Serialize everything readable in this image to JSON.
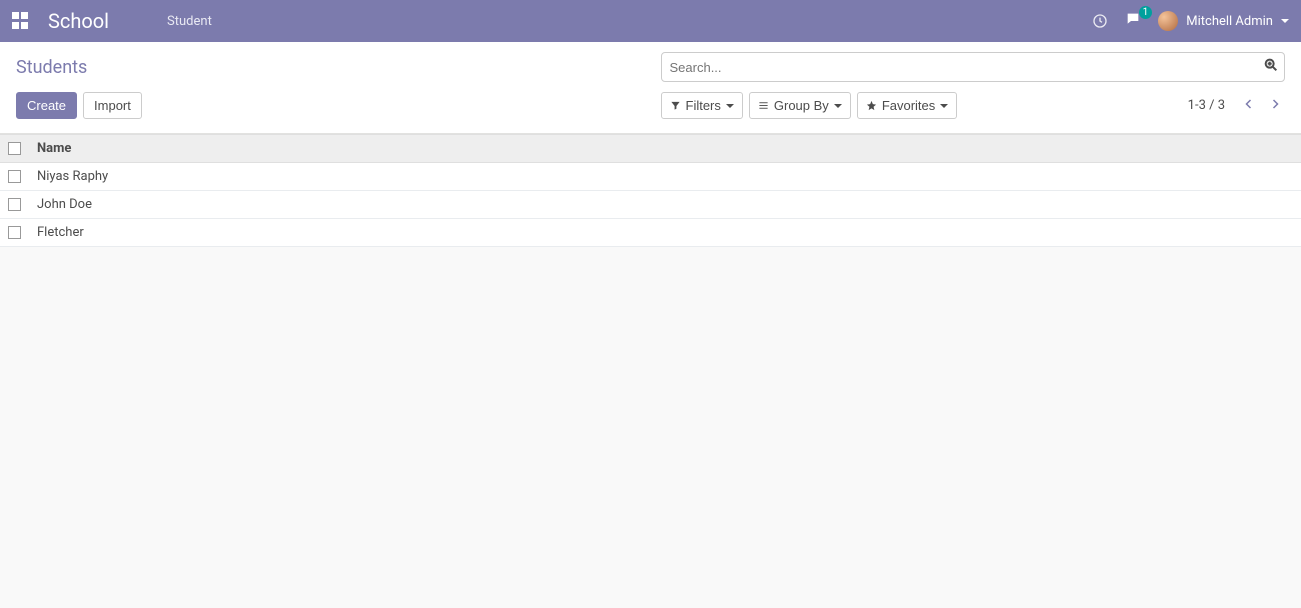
{
  "navbar": {
    "app_title": "School",
    "menu": {
      "student": "Student"
    },
    "discuss_badge": "1",
    "user_name": "Mitchell Admin"
  },
  "breadcrumb": {
    "title": "Students"
  },
  "actions": {
    "create": "Create",
    "import": "Import"
  },
  "search": {
    "placeholder": "Search..."
  },
  "filters": {
    "filters_label": "Filters",
    "groupby_label": "Group By",
    "favorites_label": "Favorites"
  },
  "pager": {
    "range": "1-3 / 3"
  },
  "table": {
    "columns": {
      "name": "Name"
    },
    "rows": [
      {
        "name": "Niyas Raphy"
      },
      {
        "name": "John Doe"
      },
      {
        "name": "Fletcher"
      }
    ]
  }
}
